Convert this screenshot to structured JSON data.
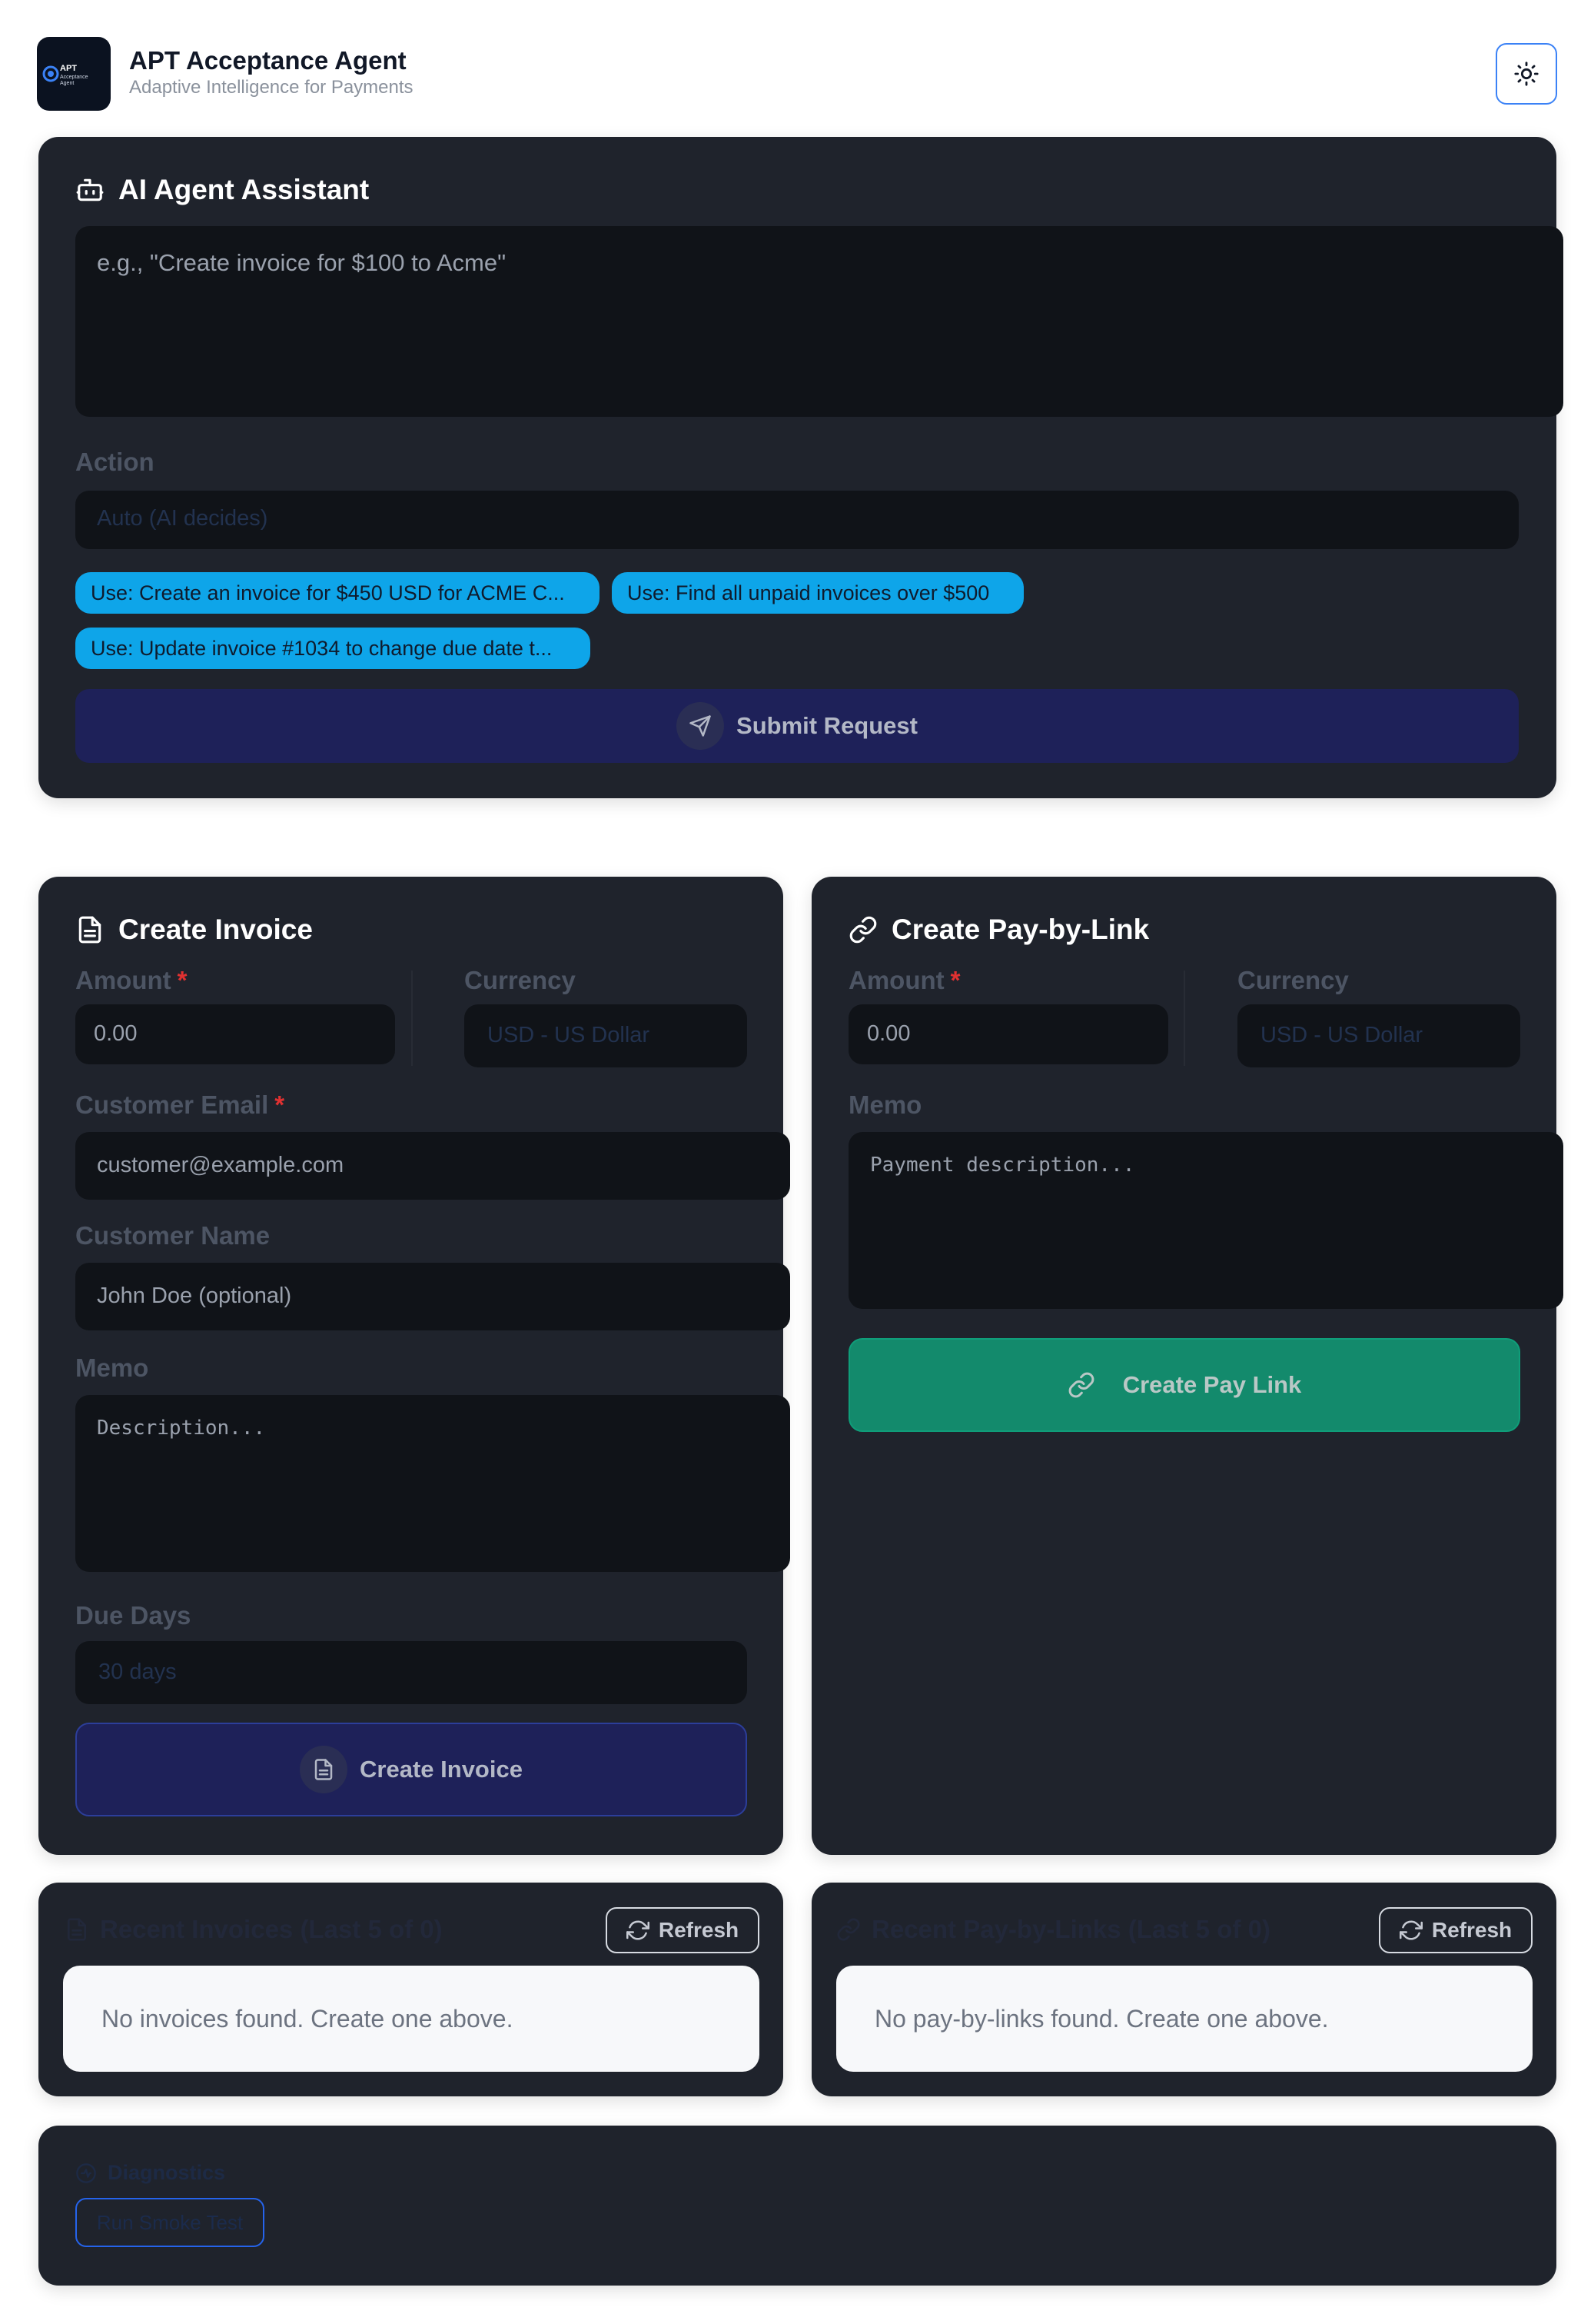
{
  "app": {
    "logo_text": "APT Acceptance Agent",
    "title": "APT Acceptance Agent",
    "subtitle": "Adaptive Intelligence for Payments",
    "theme_toggle_icon": "sun-icon"
  },
  "assistant": {
    "title": "AI Agent Assistant",
    "prompt_placeholder": "e.g., \"Create invoice for $100 to Acme\"",
    "action_label": "Action",
    "action_value": "Auto (AI decides)",
    "suggestions": [
      "Use: Create an invoice for $450 USD for ACME C...",
      "Use: Find all unpaid invoices over $500",
      "Use: Update invoice #1034 to change due date t..."
    ],
    "submit_label": "Submit Request"
  },
  "invoice_form": {
    "title": "Create Invoice",
    "amount_label": "Amount",
    "required_mark": "*",
    "amount_placeholder": "0.00",
    "currency_label": "Currency",
    "currency_value": "USD - US Dollar",
    "email_label": "Customer Email",
    "email_placeholder": "customer@example.com",
    "name_label": "Customer Name",
    "name_placeholder": "John Doe (optional)",
    "memo_label": "Memo",
    "memo_placeholder": "Description...",
    "due_label": "Due Days",
    "due_value": "30 days",
    "submit_label": "Create Invoice"
  },
  "paylink_form": {
    "title": "Create Pay-by-Link",
    "amount_label": "Amount",
    "required_mark": "*",
    "amount_placeholder": "0.00",
    "currency_label": "Currency",
    "currency_value": "USD - US Dollar",
    "memo_label": "Memo",
    "memo_placeholder": "Payment description...",
    "submit_label": "Create Pay Link"
  },
  "recent_invoices": {
    "title": "Recent Invoices (Last 5 of 0)",
    "refresh_label": "Refresh",
    "empty_text": "No invoices found. Create one above."
  },
  "recent_paylinks": {
    "title": "Recent Pay-by-Links (Last 5 of 0)",
    "refresh_label": "Refresh",
    "empty_text": "No pay-by-links found. Create one above."
  },
  "diagnostics": {
    "title": "Diagnostics",
    "smoke_test_label": "Run Smoke Test"
  }
}
